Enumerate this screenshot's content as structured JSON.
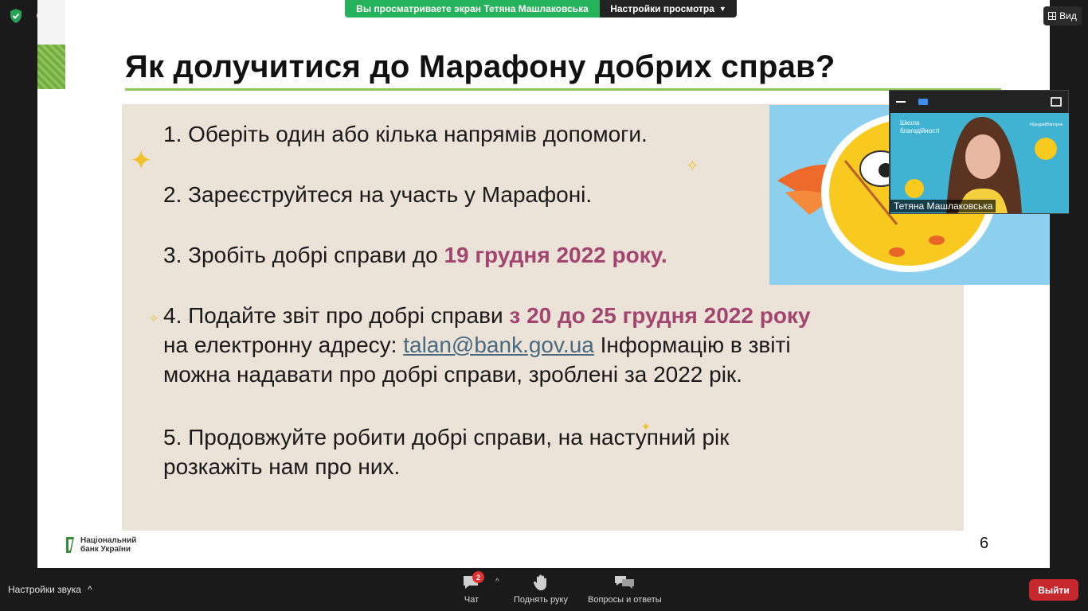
{
  "topbar": {
    "share_banner": "Вы просматриваете экран Тетяна Машлаковська",
    "view_options_label": "Настройки просмотра",
    "view_button_label": "Вид"
  },
  "slide": {
    "title": "Як долучитися до Марафону добрих справ?",
    "item1": "1. Оберіть один або кілька напрямів допомоги.",
    "item2": "2. Зареєструйтеся на участь у Марафоні.",
    "item3_text": "3. Зробіть добрі справи до ",
    "item3_accent": "19 грудня 2022 року.",
    "item4_text": "4. Подайте звіт про добрі справи ",
    "item4_accent": "з 20 до 25 грудня 2022 року",
    "item4_line2_text": "на електронну адресу: ",
    "item4_email": "talan@bank.gov.ua",
    "item4_line2_rest": " Інформацію в звіті",
    "item4_line3": "можна надавати про добрі справи, зроблені за  2022 рік.",
    "item5_line1": "5. Продовжуйте робити добрі справи, на наступний рік",
    "item5_line2": "розкажіть нам про них.",
    "page_number": "6",
    "logo_line1": "Національний",
    "logo_line2": "банк України",
    "accent_color": "#a2456f"
  },
  "video": {
    "participant_name": "Тетяна Машлаковська",
    "brand_line1": "Школа",
    "brand_line2": "благодійності",
    "hashtag": "#ЩедрийВівторок"
  },
  "toolbar": {
    "audio_settings_label": "Настройки звука",
    "chat_label": "Чат",
    "chat_badge": "2",
    "raise_hand_label": "Поднять руку",
    "qa_label": "Вопросы и ответы",
    "exit_label": "Выйти"
  }
}
